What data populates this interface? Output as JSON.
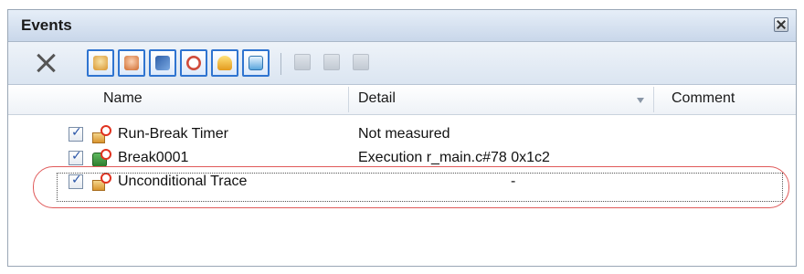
{
  "window": {
    "title": "Events"
  },
  "toolbar": {
    "buttons": [
      {
        "name": "delete",
        "icon": "delete-x-icon"
      },
      {
        "name": "toggle-1",
        "icon": "hand-break-icon",
        "color": "#e0a23a"
      },
      {
        "name": "toggle-2",
        "icon": "hand-stop-icon",
        "color": "#e07a3a"
      },
      {
        "name": "toggle-3",
        "icon": "trace-icon",
        "color": "#3a8fd0"
      },
      {
        "name": "toggle-4",
        "icon": "stopwatch-icon",
        "color": "#d04b3a"
      },
      {
        "name": "toggle-5",
        "icon": "bell-icon",
        "color": "#e3b52e"
      },
      {
        "name": "toggle-6",
        "icon": "monitor-icon",
        "color": "#3aa0d0"
      }
    ]
  },
  "table": {
    "headers": {
      "name": "Name",
      "detail": "Detail",
      "comment": "Comment"
    },
    "rows": [
      {
        "checked": true,
        "name": "Run-Break Timer",
        "detail": "Not measured",
        "comment": "",
        "icon": "timer-event-icon"
      },
      {
        "checked": true,
        "name": "Break0001",
        "detail": "Execution r_main.c#78 0x1c2",
        "comment": "",
        "icon": "break-event-icon"
      },
      {
        "checked": true,
        "name": "Unconditional Trace",
        "detail": "-",
        "comment": "",
        "icon": "trace-event-icon"
      }
    ]
  }
}
